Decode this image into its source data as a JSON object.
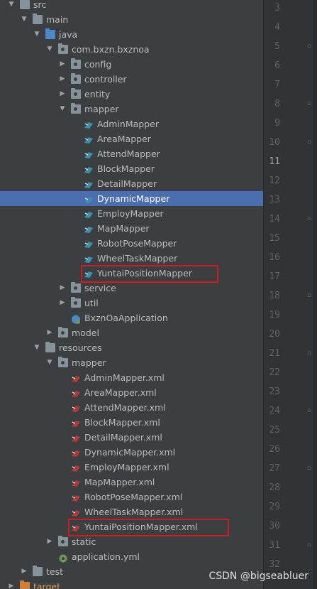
{
  "tree": [
    {
      "label": "src",
      "kind": "folder",
      "depth": 0,
      "arrow": "down"
    },
    {
      "label": "main",
      "kind": "folder",
      "depth": 1,
      "arrow": "down"
    },
    {
      "label": "java",
      "kind": "folder-blue",
      "depth": 2,
      "arrow": "down"
    },
    {
      "label": "com.bxzn.bxznoa",
      "kind": "package",
      "depth": 3,
      "arrow": "down"
    },
    {
      "label": "config",
      "kind": "package",
      "depth": 4,
      "arrow": "right"
    },
    {
      "label": "controller",
      "kind": "package",
      "depth": 4,
      "arrow": "right"
    },
    {
      "label": "entity",
      "kind": "package",
      "depth": 4,
      "arrow": "right"
    },
    {
      "label": "mapper",
      "kind": "package",
      "depth": 4,
      "arrow": "down"
    },
    {
      "label": "AdminMapper",
      "kind": "mapper",
      "depth": 5
    },
    {
      "label": "AreaMapper",
      "kind": "mapper",
      "depth": 5
    },
    {
      "label": "AttendMapper",
      "kind": "mapper",
      "depth": 5
    },
    {
      "label": "BlockMapper",
      "kind": "mapper",
      "depth": 5
    },
    {
      "label": "DetailMapper",
      "kind": "mapper",
      "depth": 5
    },
    {
      "label": "DynamicMapper",
      "kind": "mapper",
      "depth": 5,
      "selected": true
    },
    {
      "label": "EmployMapper",
      "kind": "mapper",
      "depth": 5
    },
    {
      "label": "MapMapper",
      "kind": "mapper",
      "depth": 5
    },
    {
      "label": "RobotPoseMapper",
      "kind": "mapper",
      "depth": 5
    },
    {
      "label": "WheelTaskMapper",
      "kind": "mapper",
      "depth": 5
    },
    {
      "label": "YuntaiPositionMapper",
      "kind": "mapper",
      "depth": 5,
      "highlight": true
    },
    {
      "label": "service",
      "kind": "package",
      "depth": 4,
      "arrow": "right"
    },
    {
      "label": "util",
      "kind": "package",
      "depth": 4,
      "arrow": "right"
    },
    {
      "label": "BxznOaApplication",
      "kind": "app",
      "depth": 4
    },
    {
      "label": "model",
      "kind": "package",
      "depth": 3,
      "arrow": "right"
    },
    {
      "label": "resources",
      "kind": "folder",
      "depth": 2,
      "arrow": "down"
    },
    {
      "label": "mapper",
      "kind": "package",
      "depth": 3,
      "arrow": "down"
    },
    {
      "label": "AdminMapper.xml",
      "kind": "xml",
      "depth": 4
    },
    {
      "label": "AreaMapper.xml",
      "kind": "xml",
      "depth": 4
    },
    {
      "label": "AttendMapper.xml",
      "kind": "xml",
      "depth": 4
    },
    {
      "label": "BlockMapper.xml",
      "kind": "xml",
      "depth": 4
    },
    {
      "label": "DetailMapper.xml",
      "kind": "xml",
      "depth": 4
    },
    {
      "label": "DynamicMapper.xml",
      "kind": "xml",
      "depth": 4
    },
    {
      "label": "EmployMapper.xml",
      "kind": "xml",
      "depth": 4
    },
    {
      "label": "MapMapper.xml",
      "kind": "xml",
      "depth": 4
    },
    {
      "label": "RobotPoseMapper.xml",
      "kind": "xml",
      "depth": 4
    },
    {
      "label": "WheelTaskMapper.xml",
      "kind": "xml",
      "depth": 4
    },
    {
      "label": "YuntaiPositionMapper.xml",
      "kind": "xml",
      "depth": 4,
      "highlight": true
    },
    {
      "label": "static",
      "kind": "package",
      "depth": 3,
      "arrow": "right"
    },
    {
      "label": "application.yml",
      "kind": "yml",
      "depth": 3
    },
    {
      "label": "test",
      "kind": "folder",
      "depth": 1,
      "arrow": "right"
    },
    {
      "label": "target",
      "kind": "folder-orange",
      "depth": 0,
      "arrow": "right"
    }
  ],
  "line_numbers": [
    "3",
    "4",
    "5",
    "6",
    "7",
    "8",
    "9",
    "10",
    "11",
    "12",
    "13",
    "14",
    "15",
    "16",
    "17",
    "18",
    "19",
    "20",
    "21",
    "22",
    "23",
    "24",
    "25",
    "26",
    "27",
    "28",
    "29",
    "30",
    "31",
    "32"
  ],
  "current_line": "11",
  "watermark": "CSDN @bigseabluer",
  "colors": {
    "selection": "#4b6eaf",
    "highlight_box": "#cc1e1e",
    "panel": "#3c3f41",
    "gutter": "#313335"
  }
}
